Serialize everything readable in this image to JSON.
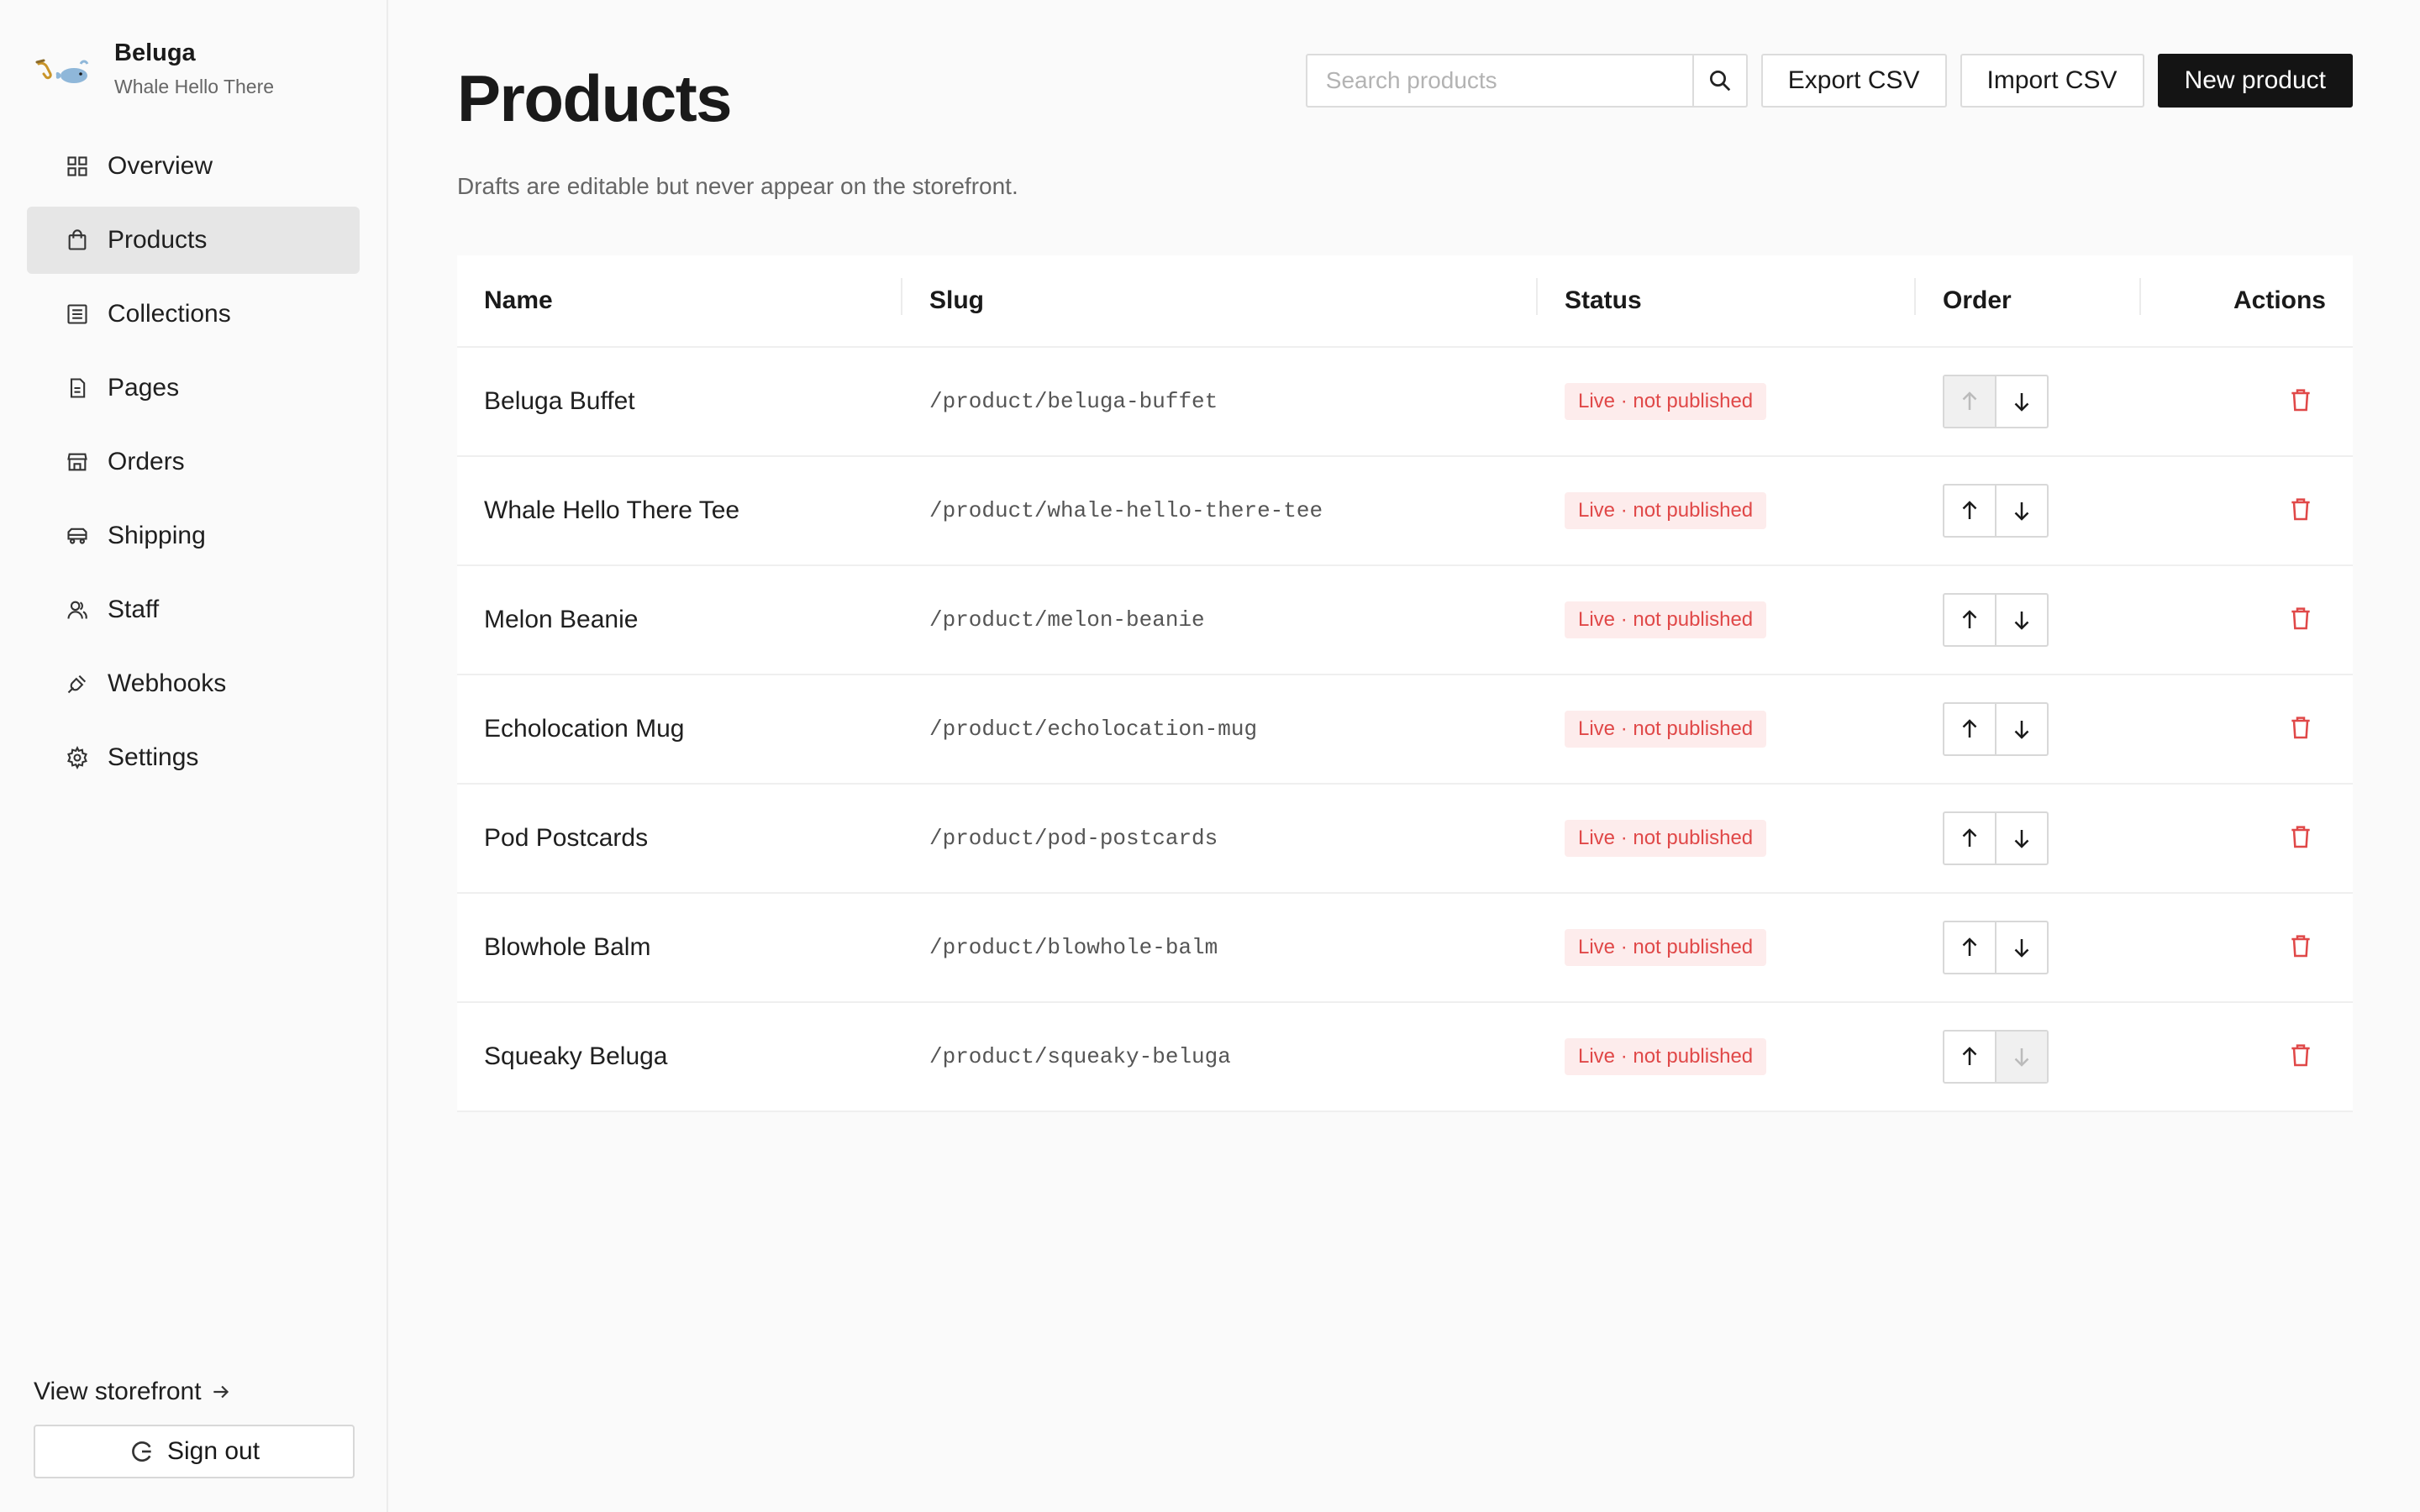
{
  "brand": {
    "name": "Beluga",
    "tagline": "Whale Hello There",
    "logo_icon": "saxophone-whale-icon"
  },
  "nav": [
    {
      "label": "Overview",
      "icon": "grid-icon",
      "active": false
    },
    {
      "label": "Products",
      "icon": "shopping-bag-icon",
      "active": true
    },
    {
      "label": "Collections",
      "icon": "list-icon",
      "active": false
    },
    {
      "label": "Pages",
      "icon": "document-icon",
      "active": false
    },
    {
      "label": "Orders",
      "icon": "storefront-icon",
      "active": false
    },
    {
      "label": "Shipping",
      "icon": "truck-icon",
      "active": false
    },
    {
      "label": "Staff",
      "icon": "users-icon",
      "active": false
    },
    {
      "label": "Webhooks",
      "icon": "plug-icon",
      "active": false
    },
    {
      "label": "Settings",
      "icon": "gear-icon",
      "active": false
    }
  ],
  "footer": {
    "view_storefront": "View storefront",
    "sign_out": "Sign out"
  },
  "page": {
    "title": "Products",
    "subtitle": "Drafts are editable but never appear on the storefront."
  },
  "toolbar": {
    "search_placeholder": "Search products",
    "export_label": "Export CSV",
    "import_label": "Import CSV",
    "new_label": "New product"
  },
  "table": {
    "headers": {
      "name": "Name",
      "slug": "Slug",
      "status": "Status",
      "order": "Order",
      "actions": "Actions"
    },
    "rows": [
      {
        "name": "Beluga Buffet",
        "slug": "/product/beluga-buffet",
        "status": "Live · not published"
      },
      {
        "name": "Whale Hello There Tee",
        "slug": "/product/whale-hello-there-tee",
        "status": "Live · not published"
      },
      {
        "name": "Melon Beanie",
        "slug": "/product/melon-beanie",
        "status": "Live · not published"
      },
      {
        "name": "Echolocation Mug",
        "slug": "/product/echolocation-mug",
        "status": "Live · not published"
      },
      {
        "name": "Pod Postcards",
        "slug": "/product/pod-postcards",
        "status": "Live · not published"
      },
      {
        "name": "Blowhole Balm",
        "slug": "/product/blowhole-balm",
        "status": "Live · not published"
      },
      {
        "name": "Squeaky Beluga",
        "slug": "/product/squeaky-beluga",
        "status": "Live · not published"
      }
    ]
  },
  "colors": {
    "primary_button": "#141414",
    "status_text": "#e04848",
    "status_bg": "#fdecec",
    "delete_icon": "#e04848",
    "active_nav_bg": "#e6e6e6"
  }
}
